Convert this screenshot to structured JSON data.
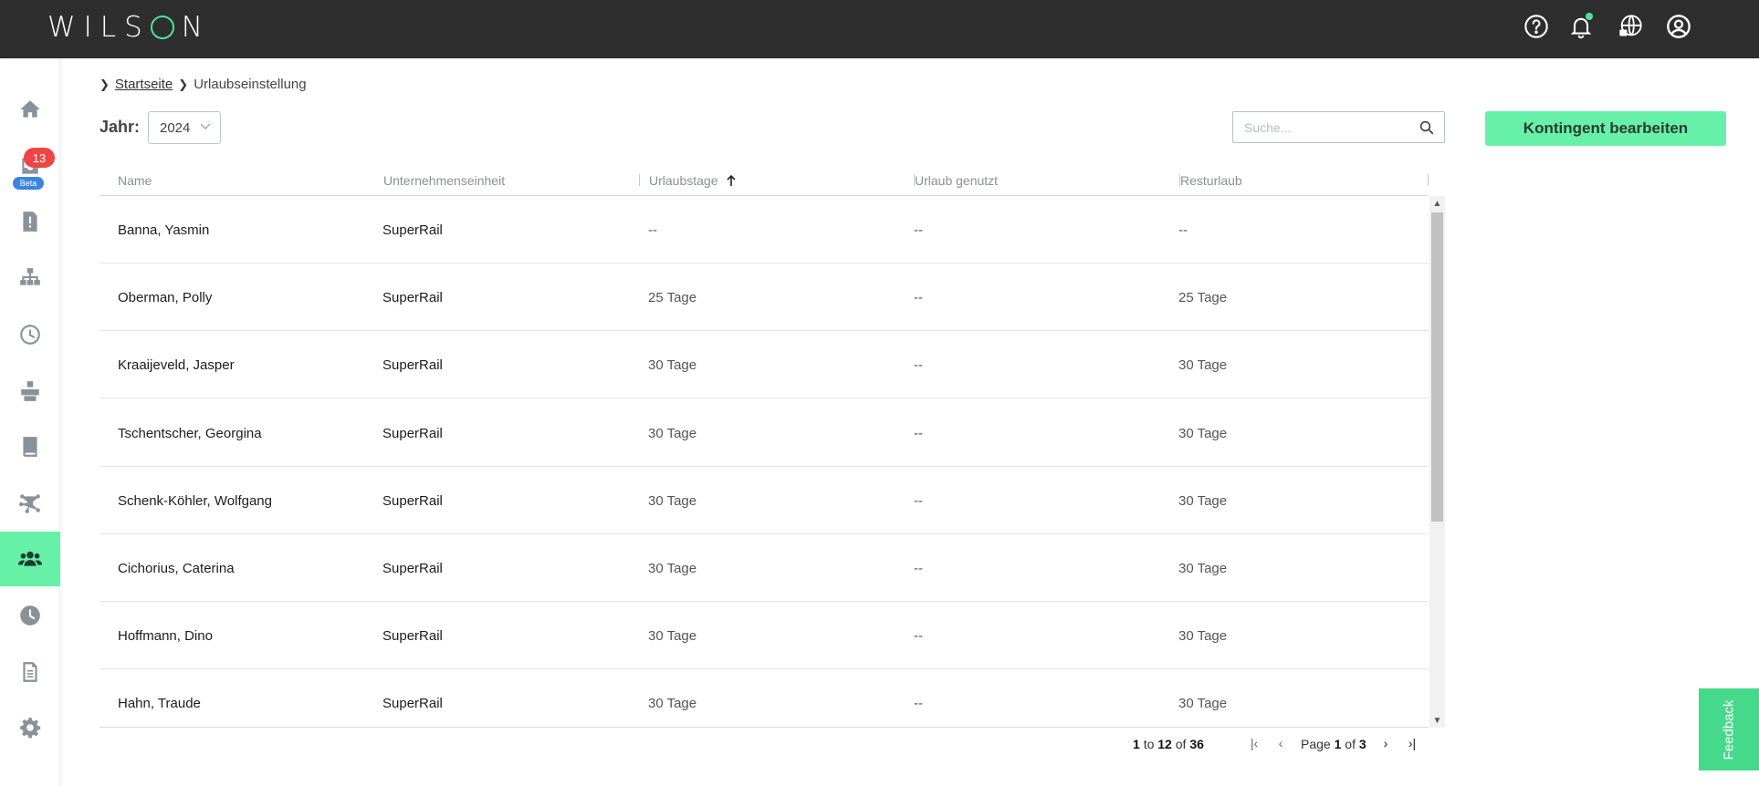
{
  "header": {
    "logo": "WILSON",
    "icons": [
      "help-icon",
      "bell-icon",
      "language-globe-icon",
      "user-account-icon"
    ]
  },
  "sidebar": {
    "badge_count": "13",
    "beta_label": "Beta",
    "items": [
      "home-icon",
      "inbox-icon",
      "document-alert-icon",
      "org-chart-icon",
      "clock-icon",
      "boxes-icon",
      "book-icon",
      "network-icon",
      "users-icon",
      "time-icon",
      "report-icon",
      "settings-icon"
    ],
    "active_index": 8
  },
  "breadcrumb": {
    "home": "Startseite",
    "current": "Urlaubseinstellung"
  },
  "filters": {
    "year_label": "Jahr:",
    "year_value": "2024"
  },
  "search": {
    "placeholder": "Suche..."
  },
  "actions": {
    "edit_quota": "Kontingent bearbeiten"
  },
  "table": {
    "columns": [
      "Name",
      "Unternehmenseinheit",
      "Urlaubstage",
      "Urlaub genutzt",
      "Resturlaub"
    ],
    "sorted_column": "Urlaubstage",
    "rows": [
      {
        "name": "Banna, Yasmin",
        "unit": "SuperRail",
        "days": "--",
        "used": "--",
        "rest": "--"
      },
      {
        "name": "Oberman, Polly",
        "unit": "SuperRail",
        "days": "25 Tage",
        "used": "--",
        "rest": "25 Tage"
      },
      {
        "name": "Kraaijeveld, Jasper",
        "unit": "SuperRail",
        "days": "30 Tage",
        "used": "--",
        "rest": "30 Tage"
      },
      {
        "name": "Tschentscher, Georgina",
        "unit": "SuperRail",
        "days": "30 Tage",
        "used": "--",
        "rest": "30 Tage"
      },
      {
        "name": "Schenk-Köhler, Wolfgang",
        "unit": "SuperRail",
        "days": "30 Tage",
        "used": "--",
        "rest": "30 Tage"
      },
      {
        "name": "Cichorius, Caterina",
        "unit": "SuperRail",
        "days": "30 Tage",
        "used": "--",
        "rest": "30 Tage"
      },
      {
        "name": "Hoffmann, Dino",
        "unit": "SuperRail",
        "days": "30 Tage",
        "used": "--",
        "rest": "30 Tage"
      },
      {
        "name": "Hahn, Traude",
        "unit": "SuperRail",
        "days": "30 Tage",
        "used": "--",
        "rest": "30 Tage"
      }
    ]
  },
  "pagination": {
    "from": "1",
    "to_word": "to",
    "to": "12",
    "of_word": "of",
    "total": "36",
    "page_word": "Page",
    "page": "1",
    "page_of_word": "of",
    "pages": "3"
  },
  "feedback": {
    "label": "Feedback"
  },
  "colors": {
    "accent": "#66f0a8",
    "topbar": "#2e2e2e",
    "badge": "#f04545",
    "beta": "#3a85e0"
  }
}
